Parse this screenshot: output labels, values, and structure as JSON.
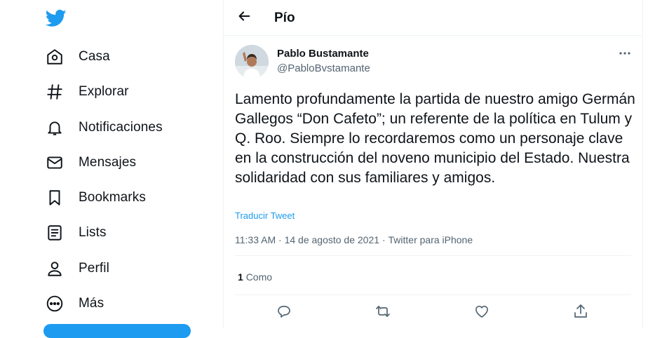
{
  "nav": {
    "items": [
      {
        "label": "Casa",
        "icon": "home-icon"
      },
      {
        "label": "Explorar",
        "icon": "hashtag-icon"
      },
      {
        "label": "Notificaciones",
        "icon": "bell-icon"
      },
      {
        "label": "Mensajes",
        "icon": "mail-icon"
      },
      {
        "label": "Bookmarks",
        "icon": "bookmark-icon"
      },
      {
        "label": "Lists",
        "icon": "list-icon"
      },
      {
        "label": "Perfil",
        "icon": "profile-icon"
      },
      {
        "label": "Más",
        "icon": "more-circle-icon"
      }
    ]
  },
  "header": {
    "title": "Pío"
  },
  "tweet": {
    "author_name": "Pablo Bustamante",
    "author_handle": "@PabloBvstamante",
    "text": "Lamento profundamente la partida de nuestro amigo Germán Gallegos “Don Cafeto”; un referente de la política en Tulum y Q. Roo. Siempre lo recordaremos como un personaje clave en la construcción del noveno municipio del Estado. Nuestra solidaridad con sus familiares y amigos.",
    "translate_label": "Traducir Tweet",
    "time": "11:33 AM",
    "date": "14 de agosto de 2021",
    "source": "Twitter para iPhone",
    "like_count": "1",
    "like_label": "Como"
  },
  "colors": {
    "accent": "#1d9bf0",
    "text": "#0f1419",
    "muted": "#536471",
    "border": "#eff3f4"
  }
}
